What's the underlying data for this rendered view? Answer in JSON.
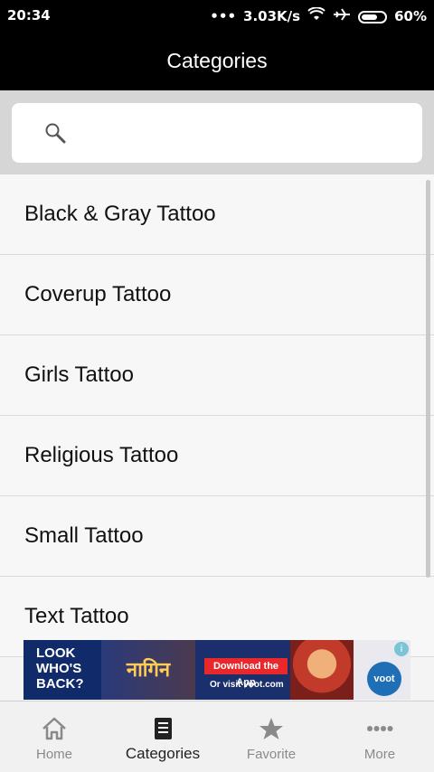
{
  "status_bar": {
    "time": "20:34",
    "network_speed": "3.03K/s",
    "battery": "60%"
  },
  "app_bar": {
    "title": "Categories"
  },
  "search": {
    "placeholder": ""
  },
  "categories": [
    {
      "label": "Black & Gray Tattoo"
    },
    {
      "label": "Coverup Tattoo"
    },
    {
      "label": "Girls Tattoo"
    },
    {
      "label": "Religious Tattoo"
    },
    {
      "label": "Small Tattoo"
    },
    {
      "label": "Text Tattoo"
    }
  ],
  "ad": {
    "headline": "LOOK WHO'S BACK?",
    "cta": "Download the App",
    "subtext": "Or visit voot.com",
    "brand": "voot"
  },
  "bottom_nav": {
    "items": [
      {
        "label": "Home",
        "icon": "home-icon",
        "active": false
      },
      {
        "label": "Categories",
        "icon": "book-icon",
        "active": true
      },
      {
        "label": "Favorite",
        "icon": "star-icon",
        "active": false
      },
      {
        "label": "More",
        "icon": "more-dots-icon",
        "active": false
      }
    ]
  },
  "colors": {
    "app_bar": "#000000",
    "search_area": "#d6d6d6",
    "list_background": "#f7f7f7",
    "nav_active": "#222222",
    "nav_inactive": "#8a8a8a"
  }
}
